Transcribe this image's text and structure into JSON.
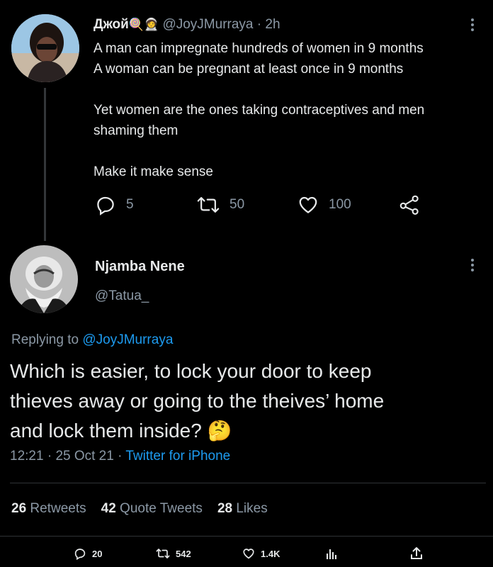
{
  "parent_tweet": {
    "name": "Джой",
    "name_emojis": "🍭🧑‍🚀",
    "handle": "@JoyJMurraya",
    "separator": "·",
    "time": "2h",
    "text_lines": [
      "A man can impregnate hundreds of women in 9 months",
      "A woman can be pregnant at least once in 9 months",
      "Yet women are the ones taking contraceptives and men",
      "shaming them",
      "Make it make sense"
    ],
    "replies": "5",
    "retweets": "50",
    "likes": "100"
  },
  "main_tweet": {
    "name": "Njamba Nene",
    "handle": "@Tatua_",
    "replying_prefix": "Replying to",
    "replying_to": "@JoyJMurraya",
    "text_lines": [
      "Which is easier, to lock your door to keep",
      "thieves away or going to the theives’ home",
      "and lock them inside? 🤔"
    ],
    "time": "12:21",
    "date": "25 Oct 21",
    "dot": "·",
    "source": "Twitter for iPhone",
    "stats": {
      "retweets_count": "26",
      "retweets_label": "Retweets",
      "quotes_count": "42",
      "quotes_label": "Quote Tweets",
      "likes_count": "28",
      "likes_label": "Likes"
    }
  },
  "bottom_bar": {
    "replies": "20",
    "retweets": "542",
    "likes": "1.4K"
  },
  "colors": {
    "background": "#000000",
    "text": "#e7e9ea",
    "muted": "#8b98a5",
    "link": "#1d9bf0",
    "divider": "#2f3336"
  }
}
